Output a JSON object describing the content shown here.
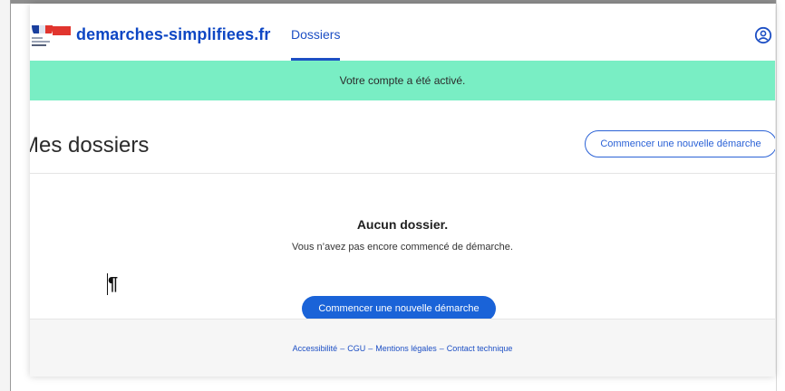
{
  "header": {
    "site_name": "demarches-simplifiees.fr",
    "nav": [
      {
        "label": "Dossiers",
        "active": true
      }
    ]
  },
  "flash": {
    "message": "Votre compte a été activé."
  },
  "main": {
    "title": "Mes dossiers",
    "new_button_label": "Commencer une nouvelle démarche",
    "empty_state": {
      "title": "Aucun dossier.",
      "text": "Vous n’avez pas encore commencé de démarche.",
      "button_label": "Commencer une nouvelle démarche"
    },
    "pilcrow": "¶"
  },
  "footer": {
    "links": [
      "Accessibilité",
      "CGU",
      "Mentions légales",
      "Contact technique"
    ],
    "separator": "–"
  },
  "colors": {
    "brand_blue": "#0e47c4",
    "link_blue": "#1d4fc4",
    "button_blue": "#1a63d8",
    "flash_green": "#79eec4",
    "footer_bg": "#f6f6f6"
  },
  "icons": {
    "logo": "marianne-flag-logo",
    "user": "user-circle-icon"
  }
}
